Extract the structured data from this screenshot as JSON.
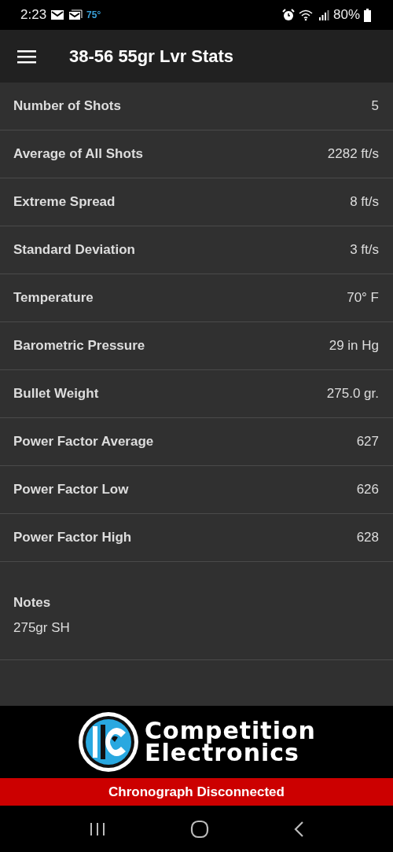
{
  "status_bar": {
    "time": "2:23",
    "temperature": "75°",
    "battery": "80%"
  },
  "app_bar": {
    "title": "38-56 55gr Lvr Stats"
  },
  "stats": [
    {
      "label": "Number of Shots",
      "value": "5"
    },
    {
      "label": "Average of All Shots",
      "value": "2282 ft/s"
    },
    {
      "label": "Extreme Spread",
      "value": "8 ft/s"
    },
    {
      "label": "Standard Deviation",
      "value": "3 ft/s"
    },
    {
      "label": "Temperature",
      "value": "70° F"
    },
    {
      "label": "Barometric Pressure",
      "value": "29 in Hg"
    },
    {
      "label": "Bullet Weight",
      "value": "275.0 gr."
    },
    {
      "label": "Power Factor Average",
      "value": "627"
    },
    {
      "label": "Power Factor Low",
      "value": "626"
    },
    {
      "label": "Power Factor High",
      "value": "628"
    }
  ],
  "notes": {
    "label": "Notes",
    "text": "275gr SH"
  },
  "logo": {
    "line_1": "Competition",
    "line_2": "Electronics"
  },
  "connection_banner": "Chronograph Disconnected"
}
